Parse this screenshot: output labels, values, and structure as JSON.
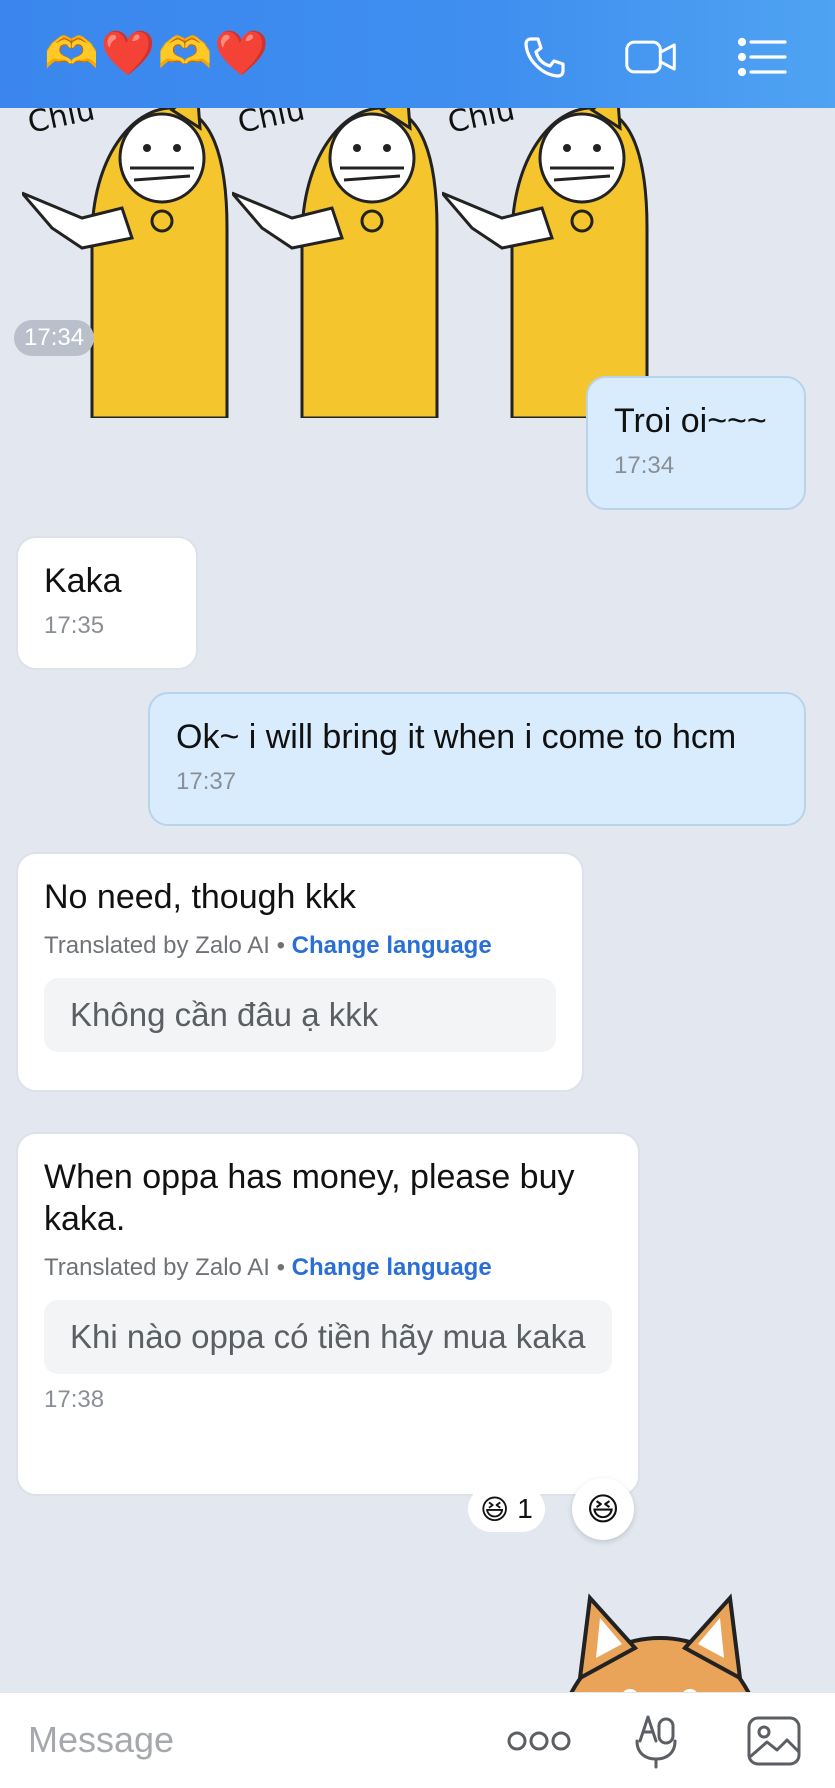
{
  "header": {
    "title": "🫶❤️🫶❤️",
    "call_icon": "phone-icon",
    "video_icon": "video-camera-icon",
    "menu_icon": "list-menu-icon",
    "background": "#3f8ff0"
  },
  "stickers": {
    "caption": "Chiu",
    "count": 3
  },
  "messages": [
    {
      "type": "time-marker",
      "time": "17:34"
    },
    {
      "type": "sent",
      "text": "Troi oi~~~",
      "time": "17:34"
    },
    {
      "type": "received",
      "text": "Kaka",
      "time": "17:35"
    },
    {
      "type": "sent",
      "text": "Ok~ i will bring it when i come to hcm",
      "time": "17:37"
    },
    {
      "type": "received",
      "text": "No need, though kkk",
      "translated_by": "Translated by Zalo AI",
      "separator": "•",
      "change_language": "Change language",
      "original": "Không cần đâu ạ kkk"
    },
    {
      "type": "received",
      "text": "When oppa has money, please buy kaka.",
      "translated_by": "Translated by Zalo AI",
      "separator": "•",
      "change_language": "Change language",
      "original": "Khi nào oppa có tiền hãy mua kaka",
      "time": "17:38",
      "reaction": {
        "emoji": "😆",
        "count": "1"
      },
      "react_button_emoji": "😆"
    }
  ],
  "composer": {
    "placeholder": "Message",
    "more_icon": "more-dots-icon",
    "voice_icon": "voice-to-text-icon",
    "image_icon": "image-gallery-icon"
  },
  "colors": {
    "sent_bubble": "#d9ecfd",
    "received_bubble": "#ffffff",
    "link": "#2a6fd6",
    "chat_background": "#e2e7f0"
  }
}
